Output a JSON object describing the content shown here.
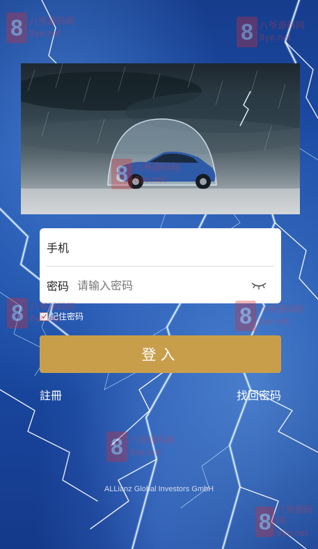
{
  "form": {
    "phone_label": "手机",
    "phone_value": "",
    "password_label": "密码",
    "password_placeholder": "请输入密码",
    "remember_label": "記住密码"
  },
  "actions": {
    "login_label": "登入",
    "register_label": "註冊",
    "recover_label": "找回密码"
  },
  "footer": {
    "text": "ALLianz Global Investors GmbH"
  },
  "watermark": {
    "brand_cn": "八爷源码网",
    "domain": "8ye.net",
    "logo_char": "8"
  },
  "colors": {
    "login_button": "#c99e4b",
    "background": "#1d4fa8",
    "watermark": "#d0303a"
  }
}
